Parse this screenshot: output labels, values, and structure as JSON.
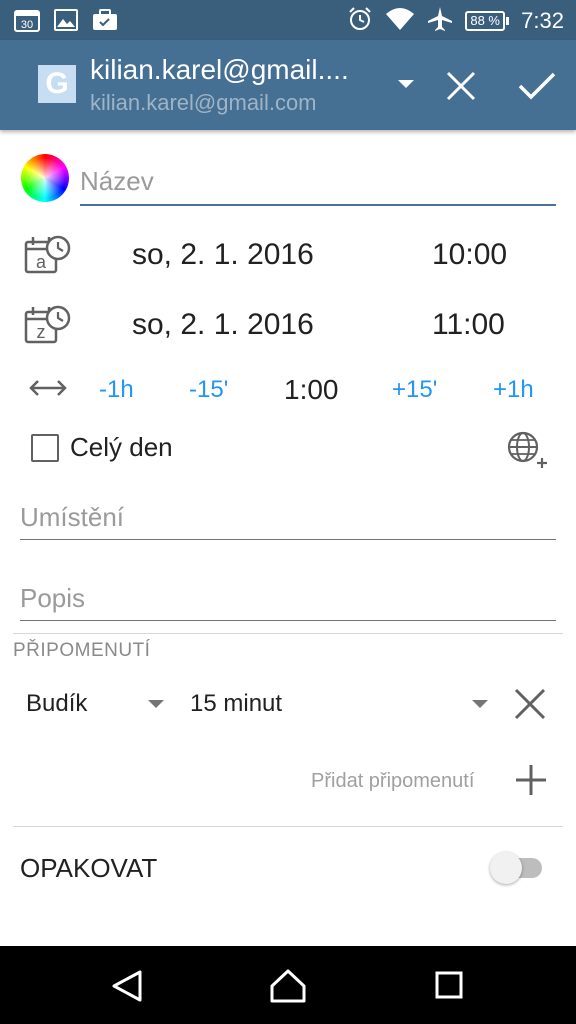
{
  "status_bar": {
    "calendar_day": "30",
    "battery_percent": "88 %",
    "time": "7:32",
    "icons": [
      "calendar-icon",
      "image-icon",
      "briefcase-icon",
      "alarm-icon",
      "wifi-icon",
      "airplane-icon",
      "battery-icon"
    ]
  },
  "app_bar": {
    "account_logo_letter": "G",
    "account_primary": "kilian.karel@gmail....",
    "account_secondary": "kilian.karel@gmail.com",
    "icons": [
      "dropdown-icon",
      "close-icon",
      "check-icon"
    ]
  },
  "event": {
    "title_placeholder": "Název",
    "start": {
      "date": "so, 2. 1. 2016",
      "time": "10:00",
      "icon_letter": "a"
    },
    "end": {
      "date": "so, 2. 1. 2016",
      "time": "11:00",
      "icon_letter": "z"
    },
    "duration": {
      "minus_1h": "-1h",
      "minus_15": "-15'",
      "value": "1:00",
      "plus_15": "+15'",
      "plus_1h": "+1h"
    },
    "all_day_label": "Celý den",
    "all_day_checked": false,
    "location_placeholder": "Umístění",
    "description_placeholder": "Popis"
  },
  "reminders": {
    "header": "PŘIPOMENUTÍ",
    "items": [
      {
        "type": "Budík",
        "time": "15 minut"
      }
    ],
    "add_label": "Přidat připomenutí"
  },
  "repeat": {
    "label": "OPAKOVAT",
    "enabled": false
  },
  "colors": {
    "status_bar": "#3a5f7d",
    "app_bar": "#456f93",
    "accent_blue": "#2196f3",
    "title_underline": "#4a7199"
  }
}
